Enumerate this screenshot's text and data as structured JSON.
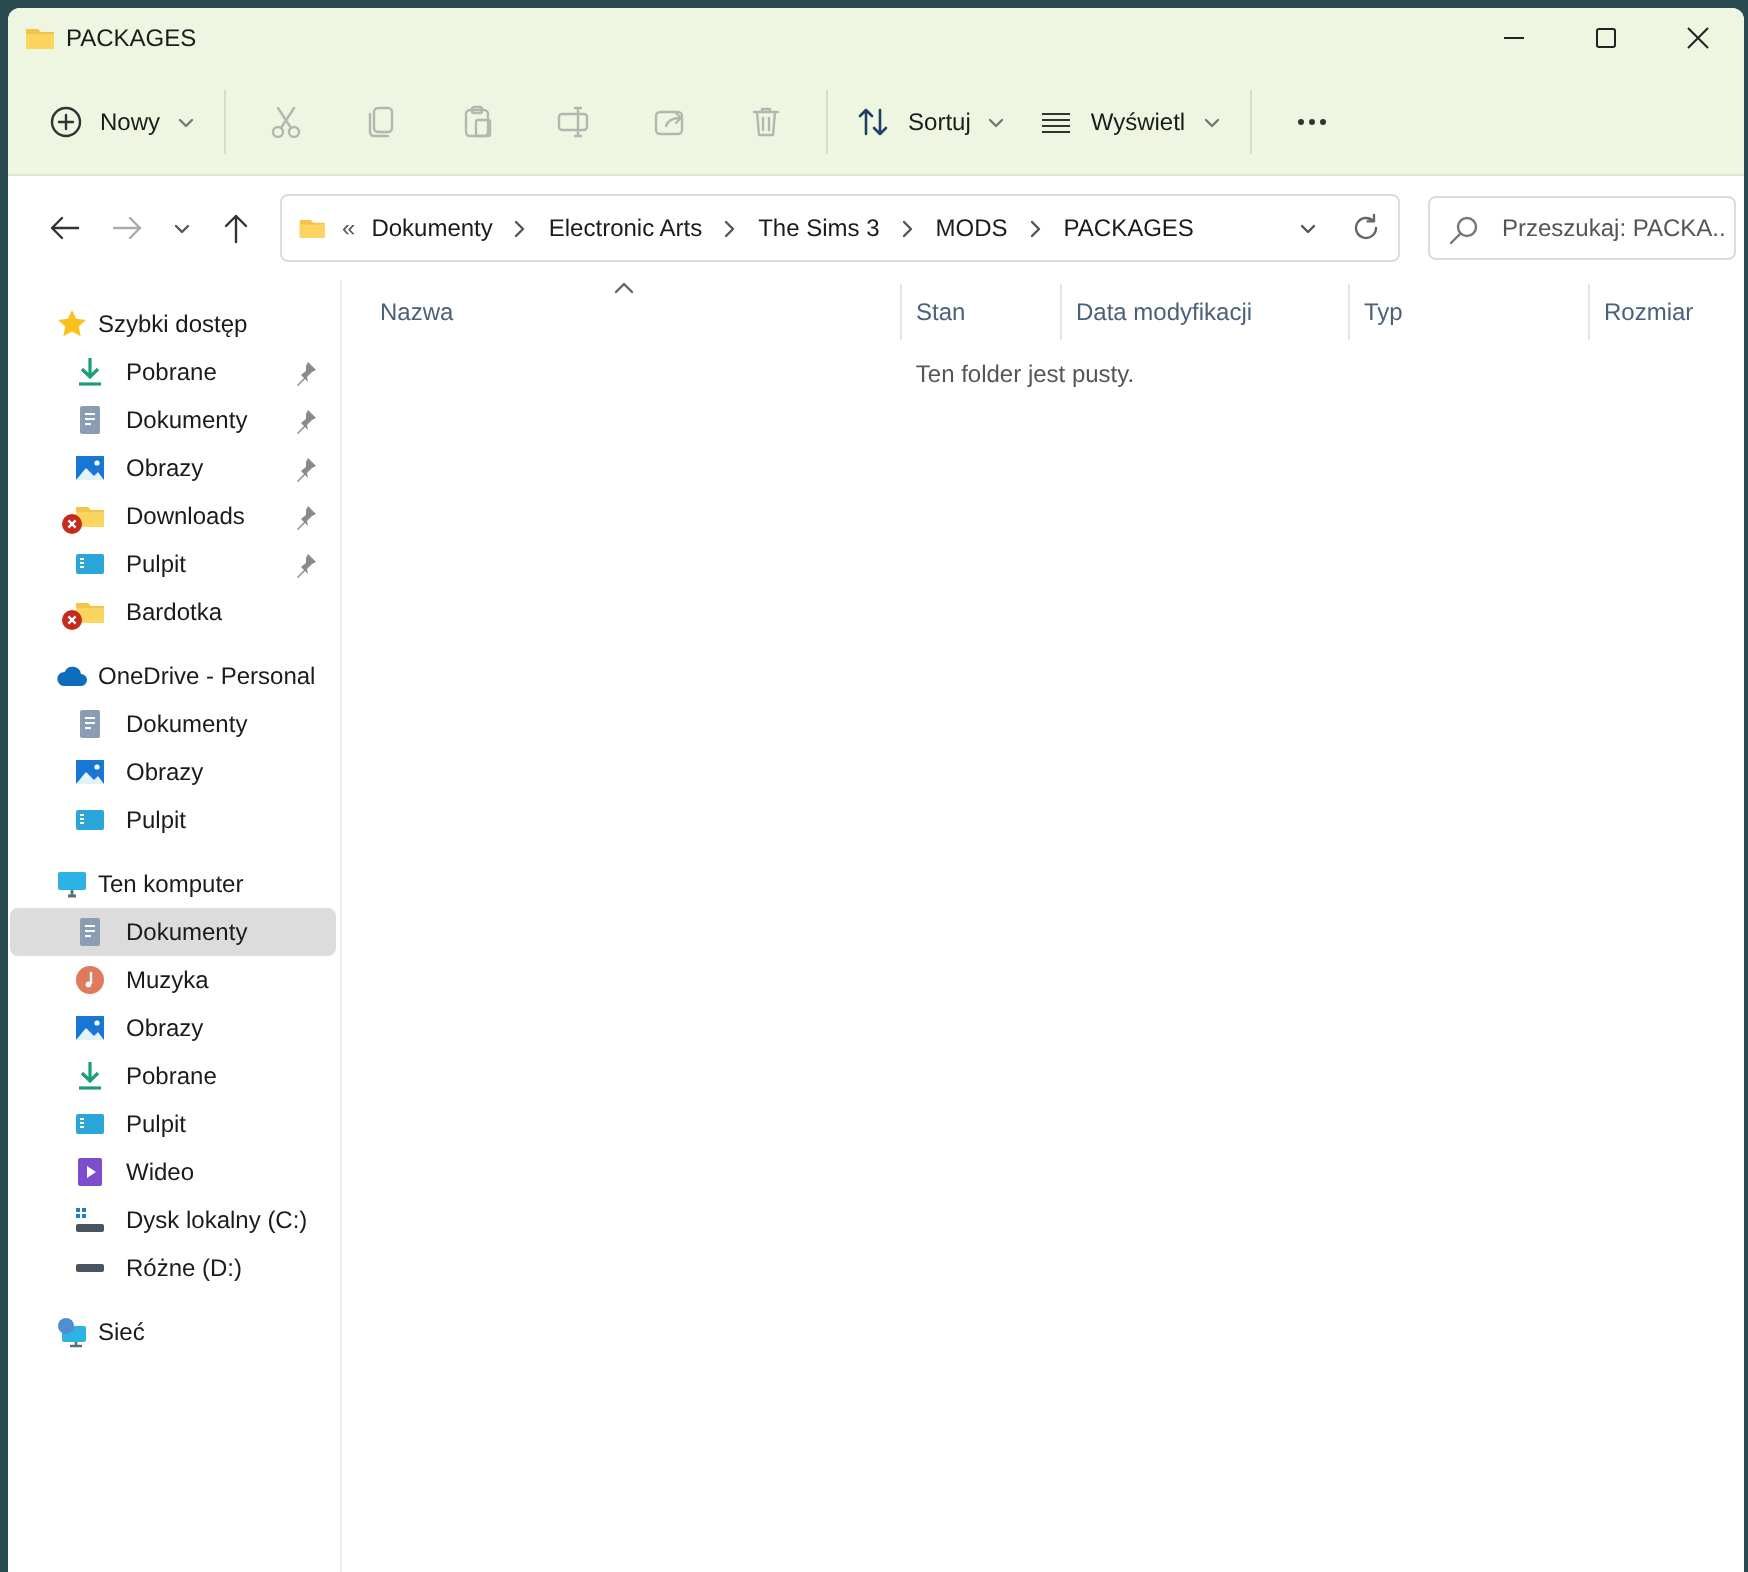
{
  "window": {
    "title": "PACKAGES"
  },
  "toolbar": [
    {
      "kind": "new",
      "label": "Nowy",
      "disabled": false
    },
    {
      "kind": "cut",
      "disabled": true
    },
    {
      "kind": "copy",
      "disabled": true
    },
    {
      "kind": "paste",
      "disabled": true
    },
    {
      "kind": "rename",
      "disabled": true
    },
    {
      "kind": "share",
      "disabled": true
    },
    {
      "kind": "delete",
      "disabled": true
    },
    {
      "kind": "sort",
      "label": "Sortuj",
      "disabled": false
    },
    {
      "kind": "view",
      "label": "Wyświetl",
      "disabled": false
    },
    {
      "kind": "more",
      "disabled": false
    }
  ],
  "navigation": {
    "back_disabled": false,
    "forward_disabled": true
  },
  "address": {
    "overflow": "«",
    "crumbs": [
      "Dokumenty",
      "Electronic Arts",
      "The Sims 3",
      "MODS",
      "PACKAGES"
    ]
  },
  "search": {
    "placeholder": "Przeszukaj: PACKA..."
  },
  "sidebar": {
    "groups": [
      {
        "label": "Szybki dostęp",
        "kind": "star",
        "items": [
          {
            "label": "Pobrane",
            "kind": "download",
            "pinned": true,
            "error": false,
            "selected": false
          },
          {
            "label": "Dokumenty",
            "kind": "document",
            "pinned": true,
            "error": false,
            "selected": false
          },
          {
            "label": "Obrazy",
            "kind": "pictures",
            "pinned": true,
            "error": false,
            "selected": false
          },
          {
            "label": "Downloads",
            "kind": "folder",
            "pinned": true,
            "error": true,
            "selected": false
          },
          {
            "label": "Pulpit",
            "kind": "desktop",
            "pinned": true,
            "error": false,
            "selected": false
          },
          {
            "label": "Bardotka",
            "kind": "folder",
            "pinned": false,
            "error": true,
            "selected": false
          }
        ]
      },
      {
        "label": "OneDrive - Personal",
        "kind": "cloud",
        "items": [
          {
            "label": "Dokumenty",
            "kind": "document",
            "pinned": false,
            "error": false,
            "selected": false
          },
          {
            "label": "Obrazy",
            "kind": "pictures",
            "pinned": false,
            "error": false,
            "selected": false
          },
          {
            "label": "Pulpit",
            "kind": "desktop",
            "pinned": false,
            "error": false,
            "selected": false
          }
        ]
      },
      {
        "label": "Ten komputer",
        "kind": "monitor",
        "items": [
          {
            "label": "Dokumenty",
            "kind": "document",
            "pinned": false,
            "error": false,
            "selected": true
          },
          {
            "label": "Muzyka",
            "kind": "music",
            "pinned": false,
            "error": false,
            "selected": false
          },
          {
            "label": "Obrazy",
            "kind": "pictures",
            "pinned": false,
            "error": false,
            "selected": false
          },
          {
            "label": "Pobrane",
            "kind": "download",
            "pinned": false,
            "error": false,
            "selected": false
          },
          {
            "label": "Pulpit",
            "kind": "desktop",
            "pinned": false,
            "error": false,
            "selected": false
          },
          {
            "label": "Wideo",
            "kind": "video",
            "pinned": false,
            "error": false,
            "selected": false
          },
          {
            "label": "Dysk lokalny (C:)",
            "kind": "system-drive",
            "pinned": false,
            "error": false,
            "selected": false
          },
          {
            "label": "Różne (D:)",
            "kind": "drive",
            "pinned": false,
            "error": false,
            "selected": false
          }
        ]
      },
      {
        "label": "Sieć",
        "kind": "network"
      }
    ]
  },
  "table": {
    "columns": [
      {
        "label": "Nazwa",
        "sorted": true
      },
      {
        "label": "Stan",
        "sorted": false
      },
      {
        "label": "Data modyfikacji",
        "sorted": false
      },
      {
        "label": "Typ",
        "sorted": false
      },
      {
        "label": "Rozmiar",
        "sorted": false
      }
    ],
    "empty_message": "Ten folder jest pusty."
  }
}
